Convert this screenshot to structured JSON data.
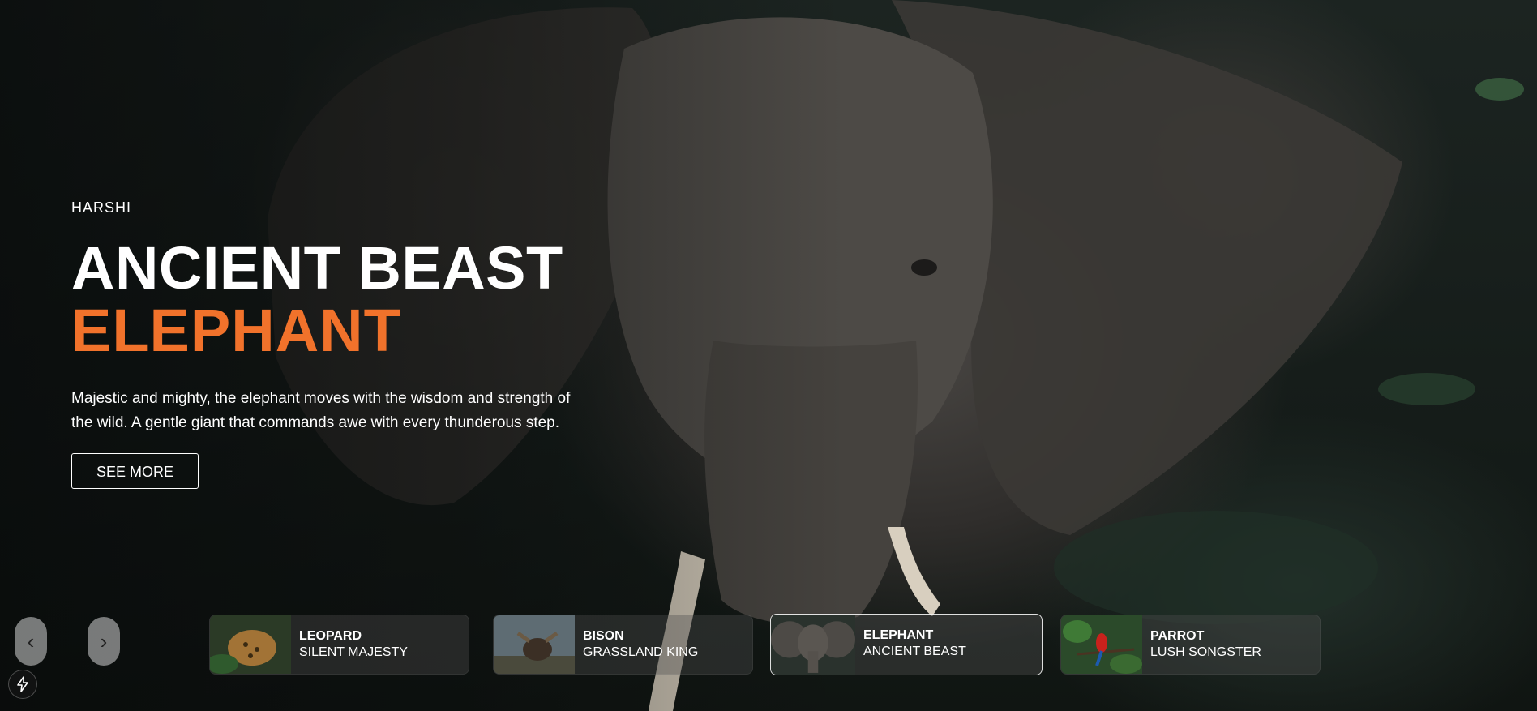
{
  "hero": {
    "brand": "HARSHI",
    "title": "ANCIENT BEAST",
    "topic": "ELEPHANT",
    "description": "Majestic and mighty, the elephant moves with the wisdom and strength of the wild. A gentle giant that commands awe with every thunderous step.",
    "button_label": "SEE MORE",
    "accent_color": "#f1722b"
  },
  "nav": {
    "prev_label": "‹",
    "next_label": "›"
  },
  "thumbnails": [
    {
      "name": "LEOPARD",
      "subtitle": "SILENT MAJESTY",
      "active": false
    },
    {
      "name": "BISON",
      "subtitle": "GRASSLAND KING",
      "active": false
    },
    {
      "name": "ELEPHANT",
      "subtitle": "ANCIENT BEAST",
      "active": true
    },
    {
      "name": "PARROT",
      "subtitle": "LUSH SONGSTER",
      "active": false
    }
  ],
  "icons": {
    "background": "elephant-photo",
    "corner": "lightning-bolt-icon"
  }
}
